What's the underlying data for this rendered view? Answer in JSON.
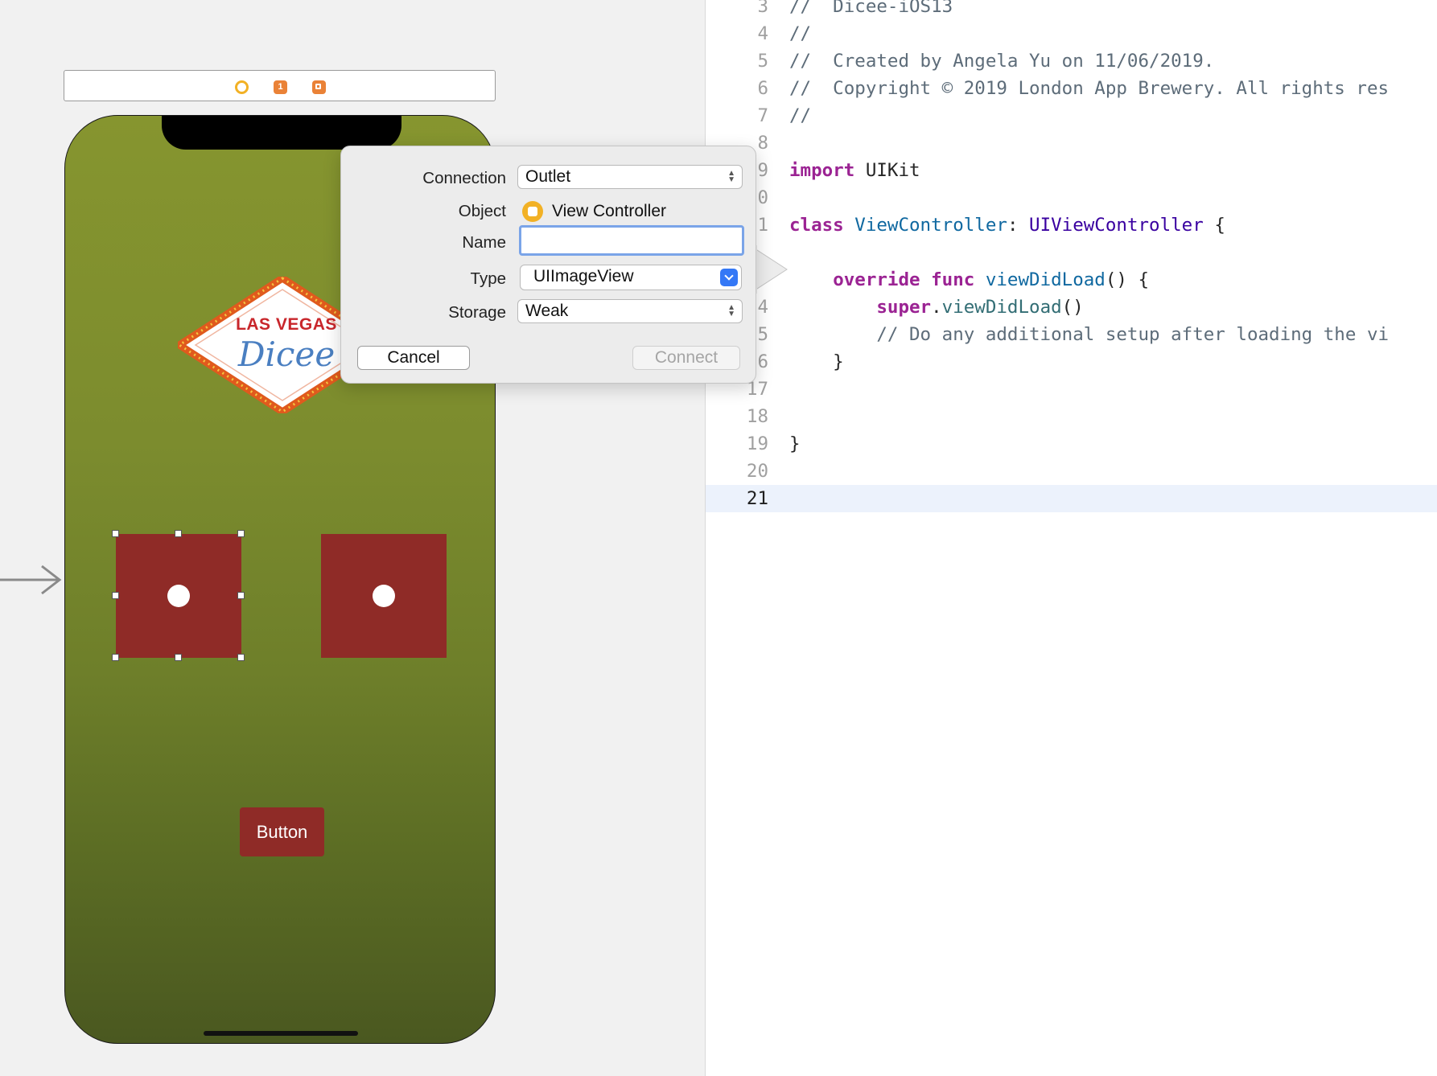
{
  "scene_bar": {
    "first_responder_glyph": "1",
    "icons": [
      "view-controller-icon",
      "first-responder-icon",
      "exit-icon"
    ]
  },
  "device": {
    "logo": {
      "line1": "LAS VEGAS",
      "line2": "Dicee"
    },
    "button_label": "Button"
  },
  "editor": {
    "current_line": 21,
    "lines": [
      {
        "n": "3",
        "text": "//  Dicee-iOS13"
      },
      {
        "n": "4",
        "text": "//"
      },
      {
        "n": "5",
        "text": "//  Created by Angela Yu on 11/06/2019."
      },
      {
        "n": "6",
        "text": "//  Copyright © 2019 London App Brewery. All rights res"
      },
      {
        "n": "7",
        "text": "//"
      },
      {
        "n": "8",
        "text": ""
      },
      {
        "n": "9",
        "text": "import UIKit"
      },
      {
        "n": "0",
        "text": ""
      },
      {
        "n": "1",
        "text": "class ViewController: UIViewController {"
      },
      {
        "n": "",
        "text": ""
      },
      {
        "n": "",
        "text": "    override func viewDidLoad() {"
      },
      {
        "n": "4",
        "text": "        super.viewDidLoad()"
      },
      {
        "n": "5",
        "text": "        // Do any additional setup after loading the vi"
      },
      {
        "n": "6",
        "text": "    }"
      },
      {
        "n": "17",
        "text": ""
      },
      {
        "n": "18",
        "text": ""
      },
      {
        "n": "19",
        "text": "}"
      },
      {
        "n": "20",
        "text": ""
      },
      {
        "n": "21",
        "text": ""
      }
    ]
  },
  "popover": {
    "connection": {
      "label": "Connection",
      "value": "Outlet"
    },
    "object": {
      "label": "Object",
      "value": "View Controller"
    },
    "name": {
      "label": "Name",
      "value": ""
    },
    "type": {
      "label": "Type",
      "value": "UIImageView"
    },
    "storage": {
      "label": "Storage",
      "value": "Weak"
    },
    "cancel_label": "Cancel",
    "connect_label": "Connect"
  },
  "colors": {
    "felt_green": "#7c8c2e",
    "die_red": "#8f2b27",
    "accent_blue": "#3478f6",
    "keyword_purple": "#9b2393",
    "comment_gray": "#5d6c79"
  }
}
